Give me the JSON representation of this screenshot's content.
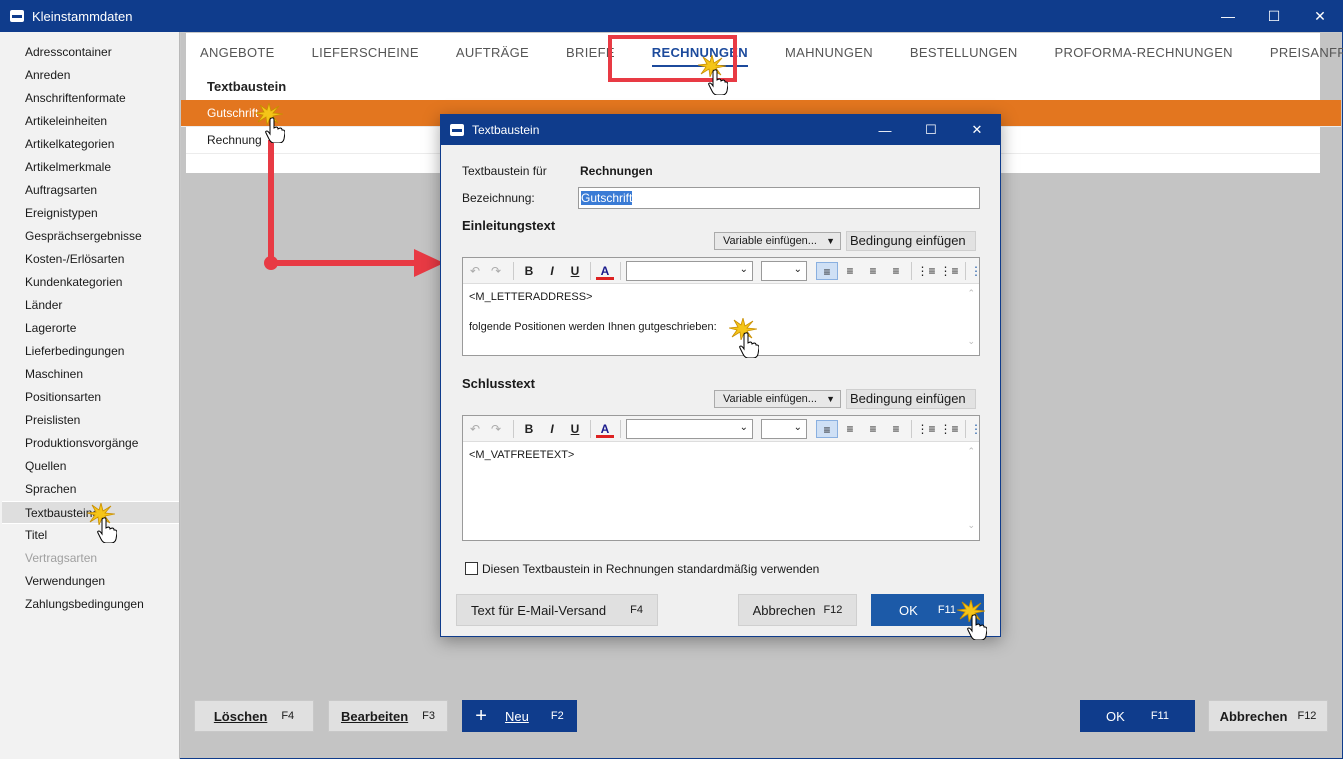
{
  "window": {
    "title": "Kleinstammdaten",
    "minimize": "—",
    "maximize": "☐",
    "close": "✕"
  },
  "sidebar": {
    "items": [
      {
        "label": "Adresscontainer"
      },
      {
        "label": "Anreden"
      },
      {
        "label": "Anschriftenformate"
      },
      {
        "label": "Artikeleinheiten"
      },
      {
        "label": "Artikelkategorien"
      },
      {
        "label": "Artikelmerkmale"
      },
      {
        "label": "Auftragsarten"
      },
      {
        "label": "Ereignistypen"
      },
      {
        "label": "Gesprächsergebnisse"
      },
      {
        "label": "Kosten-/Erlösarten"
      },
      {
        "label": "Kundenkategorien"
      },
      {
        "label": "Länder"
      },
      {
        "label": "Lagerorte"
      },
      {
        "label": "Lieferbedingungen"
      },
      {
        "label": "Maschinen"
      },
      {
        "label": "Positionsarten"
      },
      {
        "label": "Preislisten"
      },
      {
        "label": "Produktionsvorgänge"
      },
      {
        "label": "Quellen"
      },
      {
        "label": "Sprachen"
      },
      {
        "label": "Textbausteine",
        "selected": true
      },
      {
        "label": "Titel"
      },
      {
        "label": "Vertragsarten",
        "disabled": true
      },
      {
        "label": "Verwendungen"
      },
      {
        "label": "Zahlungsbedingungen"
      }
    ]
  },
  "tabs": [
    {
      "label": "ANGEBOTE"
    },
    {
      "label": "LIEFERSCHEINE"
    },
    {
      "label": "AUFTRÄGE"
    },
    {
      "label": "BRIEFE"
    },
    {
      "label": "RECHNUNGEN",
      "active": true
    },
    {
      "label": "MAHNUNGEN"
    },
    {
      "label": "BESTELLUNGEN"
    },
    {
      "label": "PROFORMA-RECHNUNGEN"
    },
    {
      "label": "PREISANFRAGEN"
    }
  ],
  "list": {
    "header": "Textbaustein",
    "rows": [
      {
        "label": "Gutschrift",
        "selected": true
      },
      {
        "label": "Rechnung"
      }
    ]
  },
  "bottom": {
    "delete_label": "Löschen",
    "delete_key": "F4",
    "edit_label": "Bearbeiten",
    "edit_key": "F3",
    "new_icon": "+",
    "new_label": "Neu",
    "new_key": "F2",
    "ok_label": "OK",
    "ok_key": "F11",
    "cancel_label": "Abbrechen",
    "cancel_key": "F12"
  },
  "dialog": {
    "title": "Textbaustein",
    "minimize": "—",
    "maximize": "☐",
    "close": "✕",
    "for_label": "Textbaustein für",
    "for_value": "Rechnungen",
    "name_label": "Bezeichnung:",
    "name_value": "Gutschrift",
    "intro_title": "Einleitungstext",
    "closing_title": "Schlusstext",
    "variable_label": "Variable einfügen...",
    "condition_label": "Bedingung einfügen",
    "intro_lines": [
      "<M_LETTERADDRESS>",
      "folgende Positionen werden Ihnen gutgeschrieben:"
    ],
    "closing_lines": [
      "<M_VATFREETEXT>"
    ],
    "checkbox_label": "Diesen Textbaustein in Rechnungen standardmäßig verwenden",
    "checkbox_checked": false,
    "email_label": "Text für E-Mail-Versand",
    "email_key": "F4",
    "cancel_label": "Abbrechen",
    "cancel_key": "F12",
    "ok_label": "OK",
    "ok_key": "F11"
  },
  "toolbar": {
    "undo": "↶",
    "redo": "↷",
    "bold": "B",
    "italic": "I",
    "underline": "U",
    "font_color": "A"
  },
  "colors": {
    "titlebar": "#0f3c8c",
    "selection": "#e3761f",
    "highlight": "#e83a44",
    "ok_button": "#1c5aa8"
  }
}
